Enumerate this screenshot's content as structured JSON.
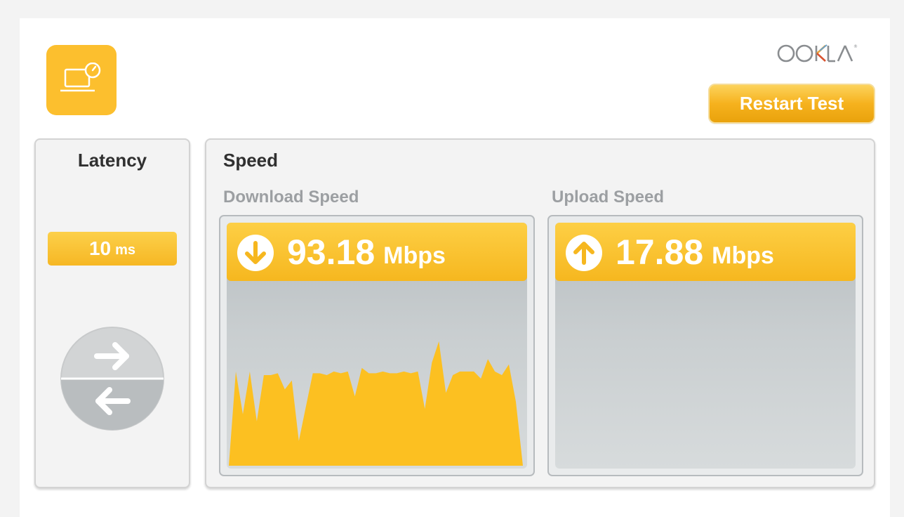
{
  "header": {
    "logo_text": "OOKLA",
    "restart_label": "Restart Test",
    "app_icon": "laptop-speedometer-icon"
  },
  "latency": {
    "title": "Latency",
    "value": "10",
    "unit": "ms",
    "icon": "ping-arrows-icon"
  },
  "speed": {
    "title": "Speed",
    "download": {
      "label": "Download Speed",
      "value": "93.18",
      "unit": "Mbps",
      "icon": "arrow-down-circle-icon"
    },
    "upload": {
      "label": "Upload Speed",
      "value": "17.88",
      "unit": "Mbps",
      "icon": "arrow-up-circle-icon"
    }
  },
  "colors": {
    "accent": "#fcbf2e",
    "chart_fill": "#fcc021",
    "text_dark": "#303030",
    "text_muted": "#9c9fa2"
  },
  "chart_data": {
    "type": "area",
    "y": [
      0,
      0.53,
      0.29,
      0.53,
      0.25,
      0.51,
      0.51,
      0.52,
      0.43,
      0.48,
      0.14,
      0.33,
      0.52,
      0.52,
      0.51,
      0.53,
      0.52,
      0.53,
      0.39,
      0.55,
      0.52,
      0.52,
      0.53,
      0.52,
      0.52,
      0.53,
      0.52,
      0.53,
      0.32,
      0.58,
      0.7,
      0.41,
      0.51,
      0.53,
      0.53,
      0.53,
      0.49,
      0.6,
      0.53,
      0.51,
      0.57,
      0.36,
      0.0
    ]
  }
}
